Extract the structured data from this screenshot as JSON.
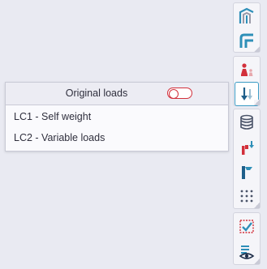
{
  "loads_panel": {
    "title": "Original loads",
    "toggle_state": "off",
    "items": [
      {
        "label": "LC1 - Self weight"
      },
      {
        "label": "LC2 - Variable loads"
      }
    ]
  },
  "toolbar": {
    "buttons": [
      {
        "icon": "frame-structure-icon"
      },
      {
        "icon": "frame-section-icon"
      },
      {
        "icon": "person-loads-icon"
      },
      {
        "icon": "load-arrows-icon",
        "active": true
      },
      {
        "icon": "database-icon"
      },
      {
        "icon": "member-load-icon"
      },
      {
        "icon": "beam-section-icon"
      },
      {
        "icon": "dot-grid-icon"
      },
      {
        "icon": "check-selection-icon"
      },
      {
        "icon": "view-list-icon"
      }
    ]
  },
  "colors": {
    "accent_blue": "#3a9ac4",
    "accent_red": "#d2303b",
    "background": "#e9eaf2"
  }
}
